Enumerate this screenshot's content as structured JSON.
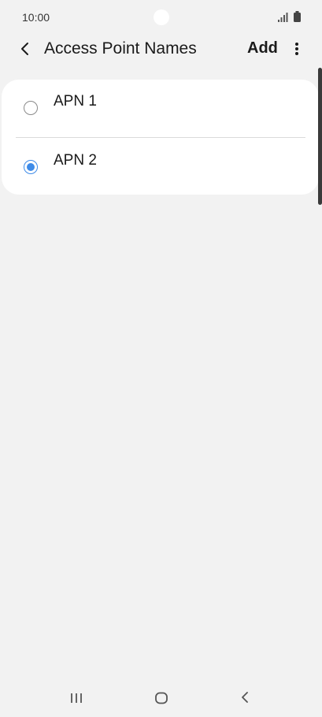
{
  "status_bar": {
    "time": "10:00",
    "icons": [
      "signal-icon",
      "battery-icon"
    ]
  },
  "app_bar": {
    "title": "Access Point Names",
    "add_label": "Add",
    "icons": [
      "back-arrow-icon",
      "more-vert-icon"
    ]
  },
  "apn_list": {
    "items": [
      {
        "label": "APN 1",
        "selected": false
      },
      {
        "label": "APN 2",
        "selected": true
      }
    ],
    "accent_color": "#3e8be8"
  },
  "nav_bar": {
    "icons": [
      "recents-icon",
      "home-icon",
      "back-icon"
    ]
  }
}
